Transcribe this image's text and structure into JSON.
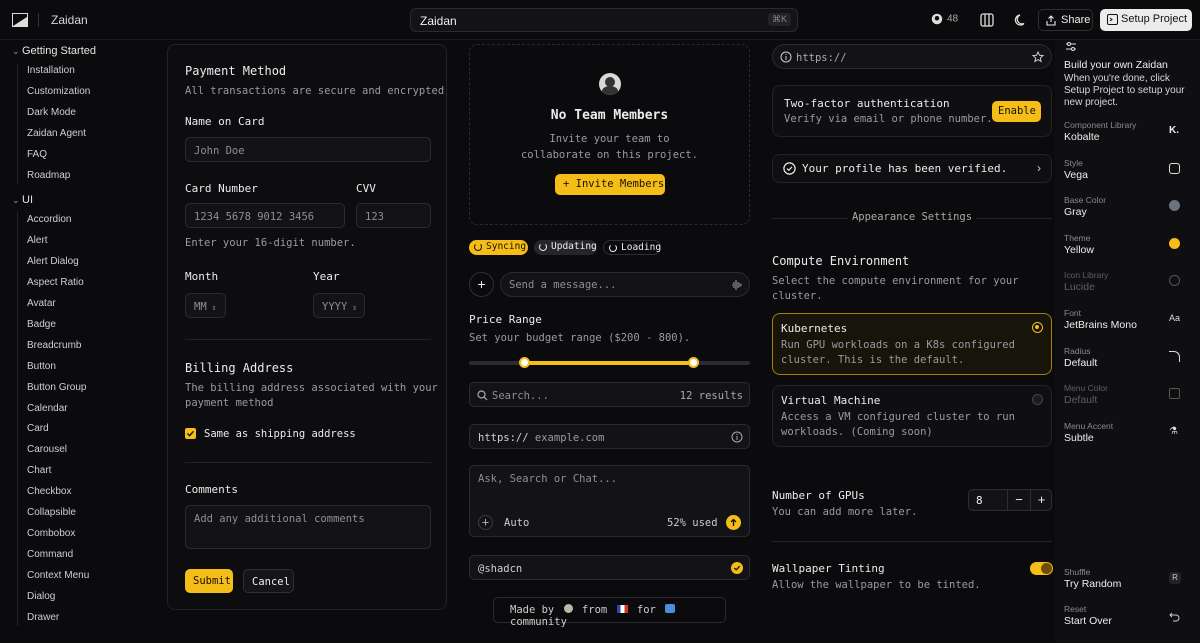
{
  "header": {
    "brand": "Zaidan",
    "command_text": "Zaidan",
    "command_shortcut": "⌘K",
    "github_stars": "48",
    "share_label": "Share",
    "setup_label": "Setup Project"
  },
  "sidebar": {
    "groups": [
      {
        "label": "Getting Started",
        "items": [
          "Installation",
          "Customization",
          "Dark Mode",
          "Zaidan Agent",
          "FAQ",
          "Roadmap"
        ]
      },
      {
        "label": "UI",
        "items": [
          "Accordion",
          "Alert",
          "Alert Dialog",
          "Aspect Ratio",
          "Avatar",
          "Badge",
          "Breadcrumb",
          "Button",
          "Button Group",
          "Calendar",
          "Card",
          "Carousel",
          "Chart",
          "Checkbox",
          "Collapsible",
          "Combobox",
          "Command",
          "Context Menu",
          "Dialog",
          "Drawer"
        ]
      }
    ]
  },
  "payment": {
    "title": "Payment Method",
    "subtitle": "All transactions are secure and encrypted",
    "name_label": "Name on Card",
    "name_placeholder": "John Doe",
    "card_label": "Card Number",
    "card_placeholder": "1234 5678 9012 3456",
    "cvv_label": "CVV",
    "cvv_placeholder": "123",
    "card_hint": "Enter your 16-digit number.",
    "month_label": "Month",
    "month_value": "MM",
    "year_label": "Year",
    "year_value": "YYYY",
    "billing_title": "Billing Address",
    "billing_subtitle_1": "The billing address associated with your",
    "billing_subtitle_2": "payment method",
    "same_address_label": "Same as shipping address",
    "comments_label": "Comments",
    "comments_placeholder": "Add any additional comments",
    "submit_label": "Submit",
    "cancel_label": "Cancel"
  },
  "team": {
    "title": "No Team Members",
    "desc_1": "Invite your team to",
    "desc_2": "collaborate on this project.",
    "invite_label": "Invite Members"
  },
  "badges": [
    "Syncing",
    "Updating",
    "Loading"
  ],
  "message": {
    "placeholder": "Send a message..."
  },
  "price": {
    "title": "Price Range",
    "subtitle": "Set your budget range ($200 - 800).",
    "min": 200,
    "max": 800,
    "range_min": 0,
    "range_max": 1000
  },
  "search": {
    "placeholder": "Search...",
    "results": "12 results"
  },
  "url": {
    "prefix": "https://",
    "placeholder": "example.com"
  },
  "chat": {
    "placeholder": "Ask, Search or Chat...",
    "mode": "Auto",
    "usage": "52% used"
  },
  "handle": {
    "value": "@shadcn"
  },
  "footer": {
    "made_by": "Made by",
    "from": "from",
    "for": "for",
    "community": "community"
  },
  "right": {
    "url_value": "https://",
    "twofa_title": "Two-factor authentication",
    "twofa_desc": "Verify via email or phone number.",
    "enable_label": "Enable",
    "verified": "Your profile has been verified.",
    "appearance": "Appearance Settings",
    "compute_title": "Compute Environment",
    "compute_desc_1": "Select the compute environment for your",
    "compute_desc_2": "cluster.",
    "k8s_title": "Kubernetes",
    "k8s_desc_1": "Run GPU workloads on a K8s configured",
    "k8s_desc_2": "cluster. This is the default.",
    "vm_title": "Virtual Machine",
    "vm_desc_1": "Access a VM configured cluster to run",
    "vm_desc_2": "workloads. (Coming soon)",
    "gpus_title": "Number of GPUs",
    "gpus_desc": "You can add more later.",
    "gpus_value": "8",
    "wall_title": "Wallpaper Tinting",
    "wall_desc": "Allow the wallpaper to be tinted."
  },
  "customizer": {
    "title": "Build your own Zaidan",
    "desc_1": "When you're done, click",
    "desc_2": "Setup Project to setup your",
    "desc_3": "new project.",
    "rows": [
      {
        "key": "Component Library",
        "value": "Kobalte"
      },
      {
        "key": "Style",
        "value": "Vega"
      },
      {
        "key": "Base Color",
        "value": "Gray"
      },
      {
        "key": "Theme",
        "value": "Yellow"
      },
      {
        "key": "Icon Library",
        "value": "Lucide"
      },
      {
        "key": "Font",
        "value": "JetBrains Mono"
      },
      {
        "key": "Radius",
        "value": "Default"
      },
      {
        "key": "Menu Color",
        "value": "Default"
      },
      {
        "key": "Menu Accent",
        "value": "Subtle"
      }
    ],
    "shuffle_key": "Shuffle",
    "shuffle_value": "Try Random",
    "reset_key": "Reset",
    "reset_value": "Start Over",
    "theme_color": "#f5bd17",
    "base_color": "#6b7280"
  }
}
